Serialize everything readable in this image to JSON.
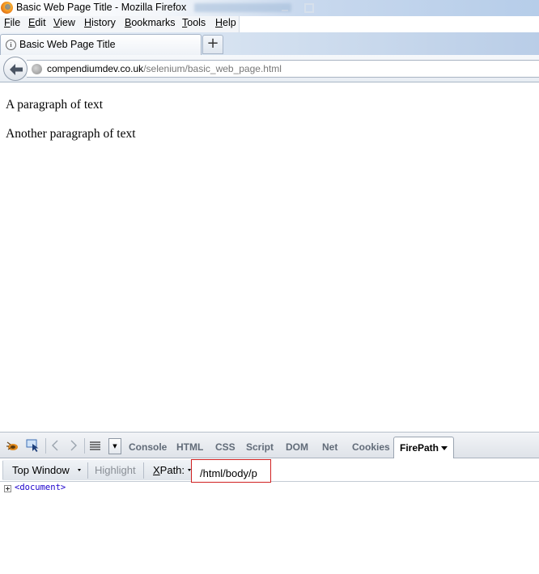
{
  "window": {
    "title": "Basic Web Page Title - Mozilla Firefox"
  },
  "menu": {
    "items": [
      "File",
      "Edit",
      "View",
      "History",
      "Bookmarks",
      "Tools",
      "Help"
    ]
  },
  "tab": {
    "title": "Basic Web Page Title",
    "new_tab_label": "+"
  },
  "address": {
    "domain": "compendiumdev.co.uk",
    "path": "/selenium/basic_web_page.html"
  },
  "page": {
    "paragraphs": [
      "A paragraph of text",
      "Another paragraph of text"
    ]
  },
  "firebug": {
    "tabs": [
      "Console",
      "HTML",
      "CSS",
      "Script",
      "DOM",
      "Net",
      "Cookies"
    ],
    "active_tab": "FirePath"
  },
  "firepath": {
    "frame_selector": "Top Window",
    "highlight_label": "Highlight",
    "xpath_label": "XPath:",
    "xpath_value": "/html/body/p",
    "tree_root": "<document>"
  },
  "colors": {
    "xpath_border": "#d02020",
    "tree_node": "#1a00cc"
  }
}
